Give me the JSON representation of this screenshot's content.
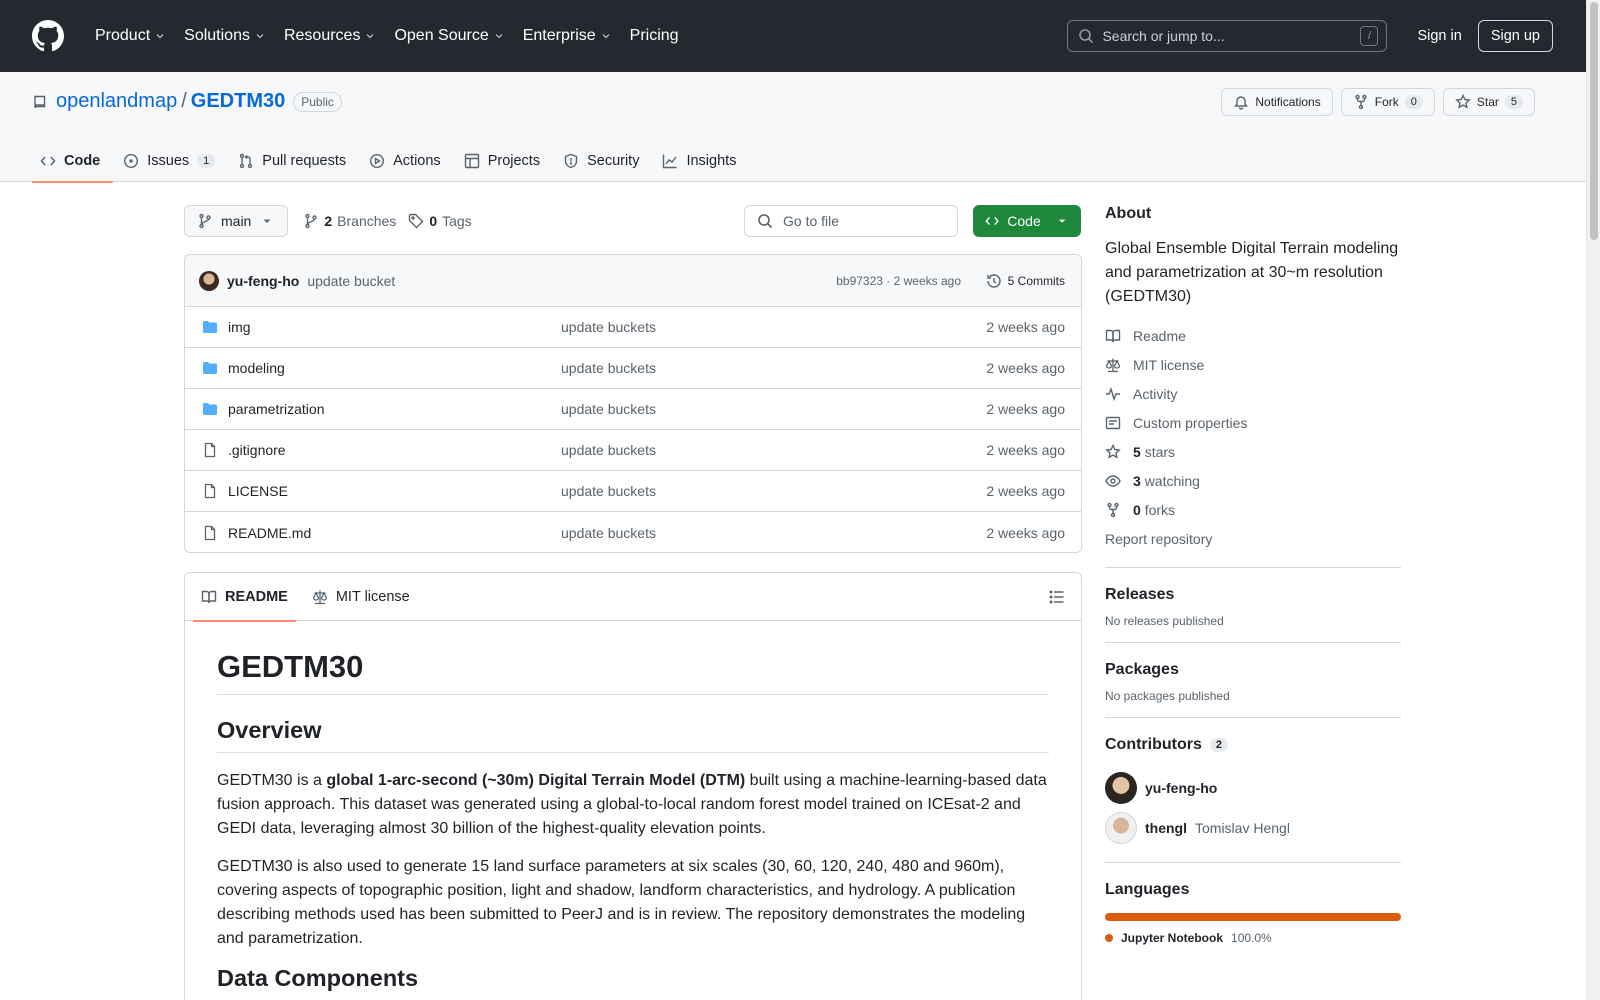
{
  "header": {
    "nav": [
      "Product",
      "Solutions",
      "Resources",
      "Open Source",
      "Enterprise",
      "Pricing"
    ],
    "search_placeholder": "Search or jump to...",
    "slash": "/",
    "sign_in": "Sign in",
    "sign_up": "Sign up"
  },
  "repo": {
    "owner": "openlandmap",
    "sep": "/",
    "name": "GEDTM30",
    "visibility": "Public",
    "notifications": "Notifications",
    "fork": "Fork",
    "fork_count": "0",
    "star": "Star",
    "star_count": "5",
    "tabs": {
      "code": "Code",
      "issues": "Issues",
      "issues_count": "1",
      "pulls": "Pull requests",
      "actions": "Actions",
      "projects": "Projects",
      "security": "Security",
      "insights": "Insights"
    }
  },
  "toolbar": {
    "branch": "main",
    "branches_count": "2",
    "branches_label": "Branches",
    "tags_count": "0",
    "tags_label": "Tags",
    "goto_placeholder": "Go to file",
    "code": "Code"
  },
  "commit": {
    "author": "yu-feng-ho",
    "message": "update bucket",
    "meta": "bb97323 · 2 weeks ago",
    "commits": "5 Commits"
  },
  "files": [
    {
      "name": "img",
      "type": "folder",
      "message": "update buckets",
      "time": "2 weeks ago"
    },
    {
      "name": "modeling",
      "type": "folder",
      "message": "update buckets",
      "time": "2 weeks ago"
    },
    {
      "name": "parametrization",
      "type": "folder",
      "message": "update buckets",
      "time": "2 weeks ago"
    },
    {
      "name": ".gitignore",
      "type": "file",
      "message": "update buckets",
      "time": "2 weeks ago"
    },
    {
      "name": "LICENSE",
      "type": "file",
      "message": "update buckets",
      "time": "2 weeks ago"
    },
    {
      "name": "README.md",
      "type": "file",
      "message": "update buckets",
      "time": "2 weeks ago"
    }
  ],
  "readme": {
    "tab_readme": "README",
    "tab_license": "MIT license",
    "h1": "GEDTM30",
    "h2_overview": "Overview",
    "p1_a": "GEDTM30 is a ",
    "p1_bold": "global 1-arc-second (~30m) Digital Terrain Model (DTM)",
    "p1_b": " built using a machine-learning-based data fusion approach. This dataset was generated using a global-to-local random forest model trained on ICEsat-2 and GEDI data, leveraging almost 30 billion of the highest-quality elevation points.",
    "p2": "GEDTM30 is also used to generate 15 land surface parameters at six scales (30, 60, 120, 240, 480 and 960m), covering aspects of topographic position, light and shadow, landform characteristics, and hydrology. A publication describing methods used has been submitted to PeerJ and is in review. The repository demonstrates the modeling and parametrization.",
    "h2_next": "Data Components"
  },
  "sidebar": {
    "about": "About",
    "description": "Global Ensemble Digital Terrain modeling and parametrization at 30~m resolution (GEDTM30)",
    "readme": "Readme",
    "license": "MIT license",
    "activity": "Activity",
    "custom": "Custom properties",
    "stars_n": "5",
    "stars": "stars",
    "watching_n": "3",
    "watching": "watching",
    "forks_n": "0",
    "forks": "forks",
    "report": "Report repository",
    "releases": "Releases",
    "no_releases": "No releases published",
    "packages": "Packages",
    "no_packages": "No packages published",
    "contributors": "Contributors",
    "contributors_count": "2",
    "contrib1": "yu-feng-ho",
    "contrib2": "thengl",
    "contrib2_full": "Tomislav Hengl",
    "languages": "Languages",
    "lang_name": "Jupyter Notebook",
    "lang_pct": "100.0%"
  },
  "colors": {
    "header_bg": "#24292f",
    "link": "#0969da",
    "primary_btn": "#1f883d",
    "tab_underline": "#fd8c73",
    "jupyter": "#da5b0b"
  }
}
